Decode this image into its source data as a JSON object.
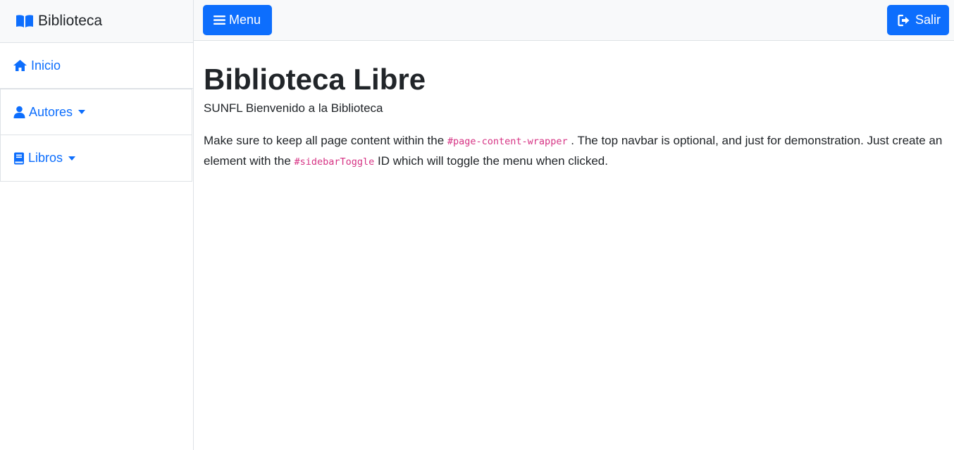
{
  "sidebar": {
    "brand": "Biblioteca",
    "items": [
      {
        "label": "Inicio",
        "icon": "home-icon"
      },
      {
        "label": "Autores",
        "icon": "user-icon"
      },
      {
        "label": "Libros",
        "icon": "book-icon"
      }
    ]
  },
  "topbar": {
    "menu_label": "Menu",
    "exit_label": "Salir"
  },
  "main": {
    "title": "Biblioteca Libre",
    "subtitle": "SUNFL Bienvenido a la Biblioteca",
    "paragraph": {
      "part1": "Make sure to keep all page content within the ",
      "code1": "#page-content-wrapper",
      "part2": " . The top navbar is optional, and just for demonstration. Just create an element with the ",
      "code2": "#sidebarToggle",
      "part3": " ID which will toggle the menu when clicked."
    }
  },
  "colors": {
    "primary": "#0d6efd",
    "text": "#212529",
    "code": "#d63384",
    "light_bg": "#f8f9fa",
    "border": "#dee2e6"
  }
}
